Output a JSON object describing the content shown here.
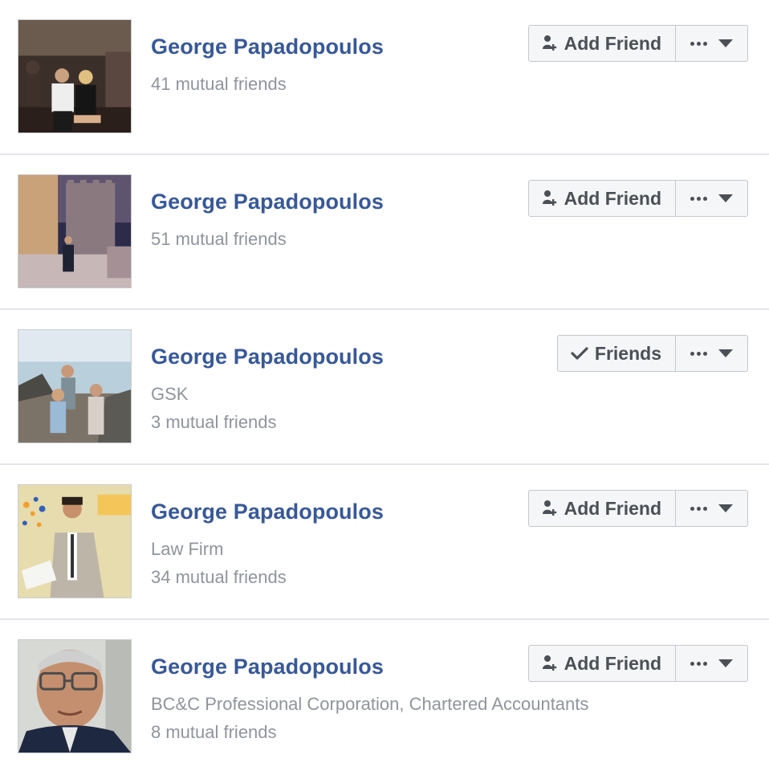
{
  "buttons": {
    "add_friend_label": "Add Friend",
    "friends_label": "Friends"
  },
  "people": [
    {
      "name": "George Papadopoulos",
      "subtitle": "",
      "mutual": "41 mutual friends",
      "status": "add",
      "photo": "couple-at-night-photo"
    },
    {
      "name": "George Papadopoulos",
      "subtitle": "",
      "mutual": "51 mutual friends",
      "status": "add",
      "photo": "castle-night-photo"
    },
    {
      "name": "George Papadopoulos",
      "subtitle": "GSK",
      "mutual": "3 mutual friends",
      "status": "friends",
      "photo": "kids-by-sea-photo"
    },
    {
      "name": "George Papadopoulos",
      "subtitle": "Law Firm",
      "mutual": "34 mutual friends",
      "status": "add",
      "photo": "speaker-podium-photo"
    },
    {
      "name": "George Papadopoulos",
      "subtitle": "BC&C Professional Corporation, Chartered Accountants",
      "mutual": "8 mutual friends",
      "status": "add",
      "photo": "elderly-man-glasses-photo"
    }
  ],
  "colors": {
    "name_link": "#385898",
    "secondary_text": "#90949c",
    "button_bg": "#f5f6f7",
    "button_border": "#c4c7cc",
    "button_text": "#4b4f56",
    "divider": "#e4e6eb"
  }
}
